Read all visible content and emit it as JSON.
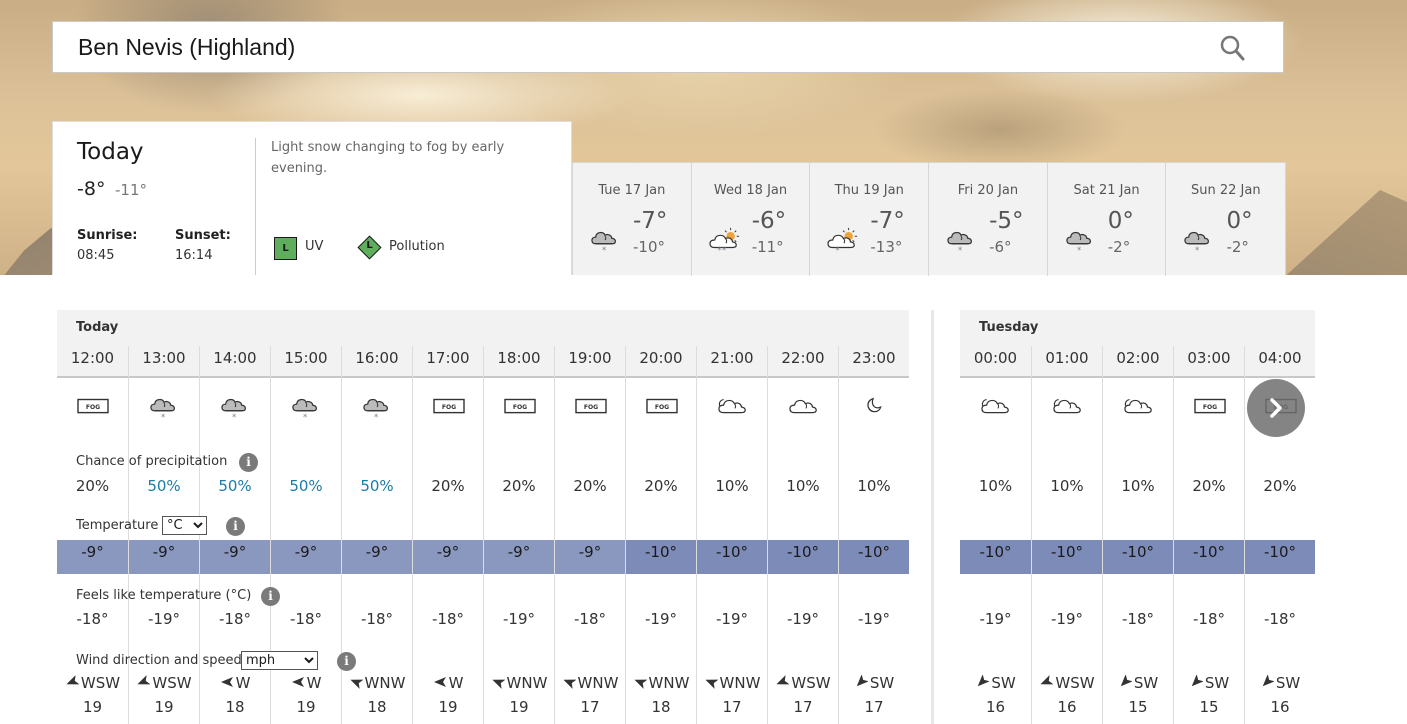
{
  "search": {
    "value": "Ben Nevis (Highland)",
    "icon": "search-icon"
  },
  "today": {
    "title": "Today",
    "high": "-8°",
    "low": "-11°",
    "sunrise_label": "Sunrise:",
    "sunrise": "08:45",
    "sunset_label": "Sunset:",
    "sunset": "16:14",
    "description": "Light snow changing to fog by early evening.",
    "uv_level": "L",
    "uv_label": "UV",
    "pollution_level": "L",
    "pollution_label": "Pollution",
    "level_color": "#5fae5d"
  },
  "days": [
    {
      "date": "Tue 17 Jan",
      "icon": "light-snow",
      "high": "-7°",
      "low": "-10°"
    },
    {
      "date": "Wed 18 Jan",
      "icon": "sunny-intervals-snow",
      "high": "-6°",
      "low": "-11°"
    },
    {
      "date": "Thu 19 Jan",
      "icon": "sunny-intervals-light-snow",
      "high": "-7°",
      "low": "-13°"
    },
    {
      "date": "Fri 20 Jan",
      "icon": "light-snow",
      "high": "-5°",
      "low": "-6°"
    },
    {
      "date": "Sat 21 Jan",
      "icon": "light-snow",
      "high": "0°",
      "low": "-2°"
    },
    {
      "date": "Sun 22 Jan",
      "icon": "light-snow",
      "high": "0°",
      "low": "-2°"
    }
  ],
  "labels": {
    "precip": "Chance of precipitation",
    "temp": "Temperature",
    "temp_unit": "°C",
    "feels": "Feels like temperature (°C)",
    "wind": "Wind direction and speed",
    "wind_unit": "mph",
    "info": "i"
  },
  "colors": {
    "temp_minus9": "#8a98c0",
    "temp_minus10": "#7c8bb8",
    "precip_high": "#1e7aa6"
  },
  "blocks": [
    {
      "title": "Today",
      "hours": [
        {
          "time": "12:00",
          "icon": "fog",
          "precip": "20%",
          "temp": "-9°",
          "feels": "-18°",
          "wind_dir": "WSW",
          "wind_speed": "19"
        },
        {
          "time": "13:00",
          "icon": "light-snow",
          "precip": "50%",
          "temp": "-9°",
          "feels": "-19°",
          "wind_dir": "WSW",
          "wind_speed": "19"
        },
        {
          "time": "14:00",
          "icon": "light-snow",
          "precip": "50%",
          "temp": "-9°",
          "feels": "-18°",
          "wind_dir": "W",
          "wind_speed": "18"
        },
        {
          "time": "15:00",
          "icon": "light-snow",
          "precip": "50%",
          "temp": "-9°",
          "feels": "-18°",
          "wind_dir": "W",
          "wind_speed": "19"
        },
        {
          "time": "16:00",
          "icon": "light-snow",
          "precip": "50%",
          "temp": "-9°",
          "feels": "-18°",
          "wind_dir": "WNW",
          "wind_speed": "18"
        },
        {
          "time": "17:00",
          "icon": "fog",
          "precip": "20%",
          "temp": "-9°",
          "feels": "-18°",
          "wind_dir": "W",
          "wind_speed": "19"
        },
        {
          "time": "18:00",
          "icon": "fog",
          "precip": "20%",
          "temp": "-9°",
          "feels": "-19°",
          "wind_dir": "WNW",
          "wind_speed": "19"
        },
        {
          "time": "19:00",
          "icon": "fog",
          "precip": "20%",
          "temp": "-9°",
          "feels": "-18°",
          "wind_dir": "WNW",
          "wind_speed": "17"
        },
        {
          "time": "20:00",
          "icon": "fog",
          "precip": "20%",
          "temp": "-10°",
          "feels": "-19°",
          "wind_dir": "WNW",
          "wind_speed": "18"
        },
        {
          "time": "21:00",
          "icon": "partly-cloudy-night",
          "precip": "10%",
          "temp": "-10°",
          "feels": "-19°",
          "wind_dir": "WNW",
          "wind_speed": "17"
        },
        {
          "time": "22:00",
          "icon": "cloudy",
          "precip": "10%",
          "temp": "-10°",
          "feels": "-19°",
          "wind_dir": "WSW",
          "wind_speed": "17"
        },
        {
          "time": "23:00",
          "icon": "clear-night",
          "precip": "10%",
          "temp": "-10°",
          "feels": "-19°",
          "wind_dir": "SW",
          "wind_speed": "17"
        }
      ]
    },
    {
      "title": "Tuesday",
      "hours": [
        {
          "time": "00:00",
          "icon": "partly-cloudy-night",
          "precip": "10%",
          "temp": "-10°",
          "feels": "-19°",
          "wind_dir": "SW",
          "wind_speed": "16"
        },
        {
          "time": "01:00",
          "icon": "partly-cloudy-night",
          "precip": "10%",
          "temp": "-10°",
          "feels": "-19°",
          "wind_dir": "WSW",
          "wind_speed": "16"
        },
        {
          "time": "02:00",
          "icon": "partly-cloudy-night",
          "precip": "10%",
          "temp": "-10°",
          "feels": "-18°",
          "wind_dir": "SW",
          "wind_speed": "15"
        },
        {
          "time": "03:00",
          "icon": "fog",
          "precip": "20%",
          "temp": "-10°",
          "feels": "-18°",
          "wind_dir": "SW",
          "wind_speed": "15"
        },
        {
          "time": "04:00",
          "icon": "fog",
          "precip": "20%",
          "temp": "-10°",
          "feels": "-18°",
          "wind_dir": "SW",
          "wind_speed": "16"
        }
      ]
    }
  ],
  "fog_text": "FOG",
  "next_button": {
    "icon": "chevron-right-icon"
  }
}
